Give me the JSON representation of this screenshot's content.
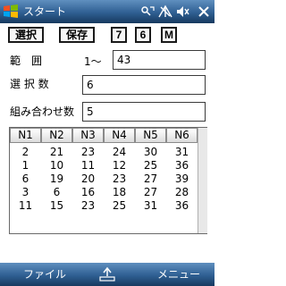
{
  "titlebar": {
    "title": "スタート"
  },
  "toolbar": {
    "select_label": "選択",
    "save_label": "保存",
    "btn7_label": "7",
    "btn6_label": "6",
    "btnM_label": "M"
  },
  "form": {
    "range_label": "範　囲",
    "range_prefix": "1〜",
    "range_value": "43",
    "select_count_label": "選 択 数",
    "select_count_value": "6",
    "combo_count_label": "組み合わせ数",
    "combo_count_value": "5"
  },
  "table": {
    "headers": [
      "N1",
      "N2",
      "N3",
      "N4",
      "N5",
      "N6"
    ],
    "rows": [
      [
        "2",
        "21",
        "23",
        "24",
        "30",
        "31"
      ],
      [
        "1",
        "10",
        "11",
        "12",
        "25",
        "36"
      ],
      [
        "6",
        "19",
        "20",
        "23",
        "27",
        "39"
      ],
      [
        "3",
        "6",
        "16",
        "18",
        "27",
        "28"
      ],
      [
        "11",
        "15",
        "23",
        "25",
        "31",
        "36"
      ]
    ]
  },
  "menubar": {
    "left_label": "ファイル",
    "right_label": "メニュー"
  },
  "icons": {
    "start": "windows-flag-icon",
    "status": [
      "connectivity-icon",
      "signal-icon",
      "speaker-icon",
      "close-icon"
    ],
    "input": "keyboard-icon"
  },
  "colors": {
    "bar_top": "#5f8fbf",
    "bar_bottom": "#17395f"
  }
}
